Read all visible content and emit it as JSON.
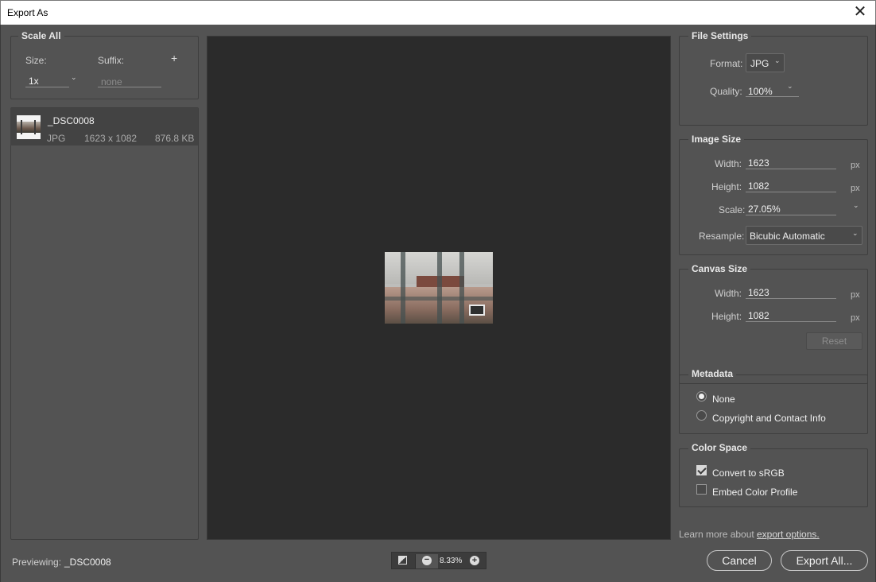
{
  "window": {
    "title": "Export As",
    "close_icon": "close-icon"
  },
  "scale_all": {
    "title": "Scale All",
    "size_label": "Size:",
    "suffix_label": "Suffix:",
    "add_symbol": "+",
    "size_value": "1x",
    "suffix_placeholder": "none"
  },
  "file_list": [
    {
      "name": "_DSC0008",
      "format": "JPG",
      "dimensions": "1623 x 1082",
      "size": "876.8 KB"
    }
  ],
  "previewing": {
    "label": "Previewing:",
    "name": "_DSC0008"
  },
  "zoom": {
    "value": "8.33%"
  },
  "file_settings": {
    "title": "File Settings",
    "format_label": "Format:",
    "format_value": "JPG",
    "quality_label": "Quality:",
    "quality_value": "100%"
  },
  "image_size": {
    "title": "Image Size",
    "width_label": "Width:",
    "width_value": "1623",
    "height_label": "Height:",
    "height_value": "1082",
    "scale_label": "Scale:",
    "scale_value": "27.05%",
    "resample_label": "Resample:",
    "resample_value": "Bicubic Automatic",
    "unit": "px"
  },
  "canvas_size": {
    "title": "Canvas Size",
    "width_label": "Width:",
    "width_value": "1623",
    "height_label": "Height:",
    "height_value": "1082",
    "unit": "px",
    "reset_label": "Reset"
  },
  "metadata": {
    "title": "Metadata",
    "options": [
      "None",
      "Copyright and Contact Info"
    ],
    "selected": "None"
  },
  "color_space": {
    "title": "Color Space",
    "convert_label": "Convert to sRGB",
    "convert_checked": true,
    "embed_label": "Embed Color Profile",
    "embed_checked": false
  },
  "footer": {
    "learn_more": "Learn more about",
    "learn_link": "export options.",
    "cancel_label": "Cancel",
    "export_label": "Export All..."
  },
  "colors": {
    "background": "#535353",
    "preview": "#2b2b2b",
    "title_bar": "#ffffff"
  }
}
